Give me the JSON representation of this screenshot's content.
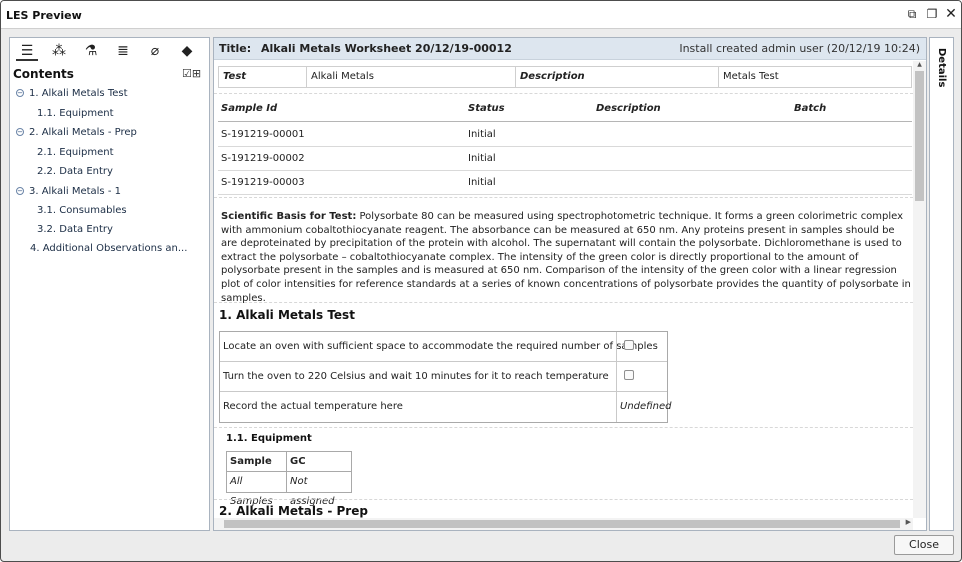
{
  "window": {
    "title": "LES Preview"
  },
  "left": {
    "contents_title": "Contents",
    "tree": [
      {
        "label": "1.  Alkali Metals Test",
        "toggle": "−"
      },
      {
        "label": "1.1.  Equipment"
      },
      {
        "label": "2.  Alkali Metals - Prep",
        "toggle": "−"
      },
      {
        "label": "2.1.  Equipment"
      },
      {
        "label": "2.2.  Data Entry"
      },
      {
        "label": "3.  Alkali Metals - 1",
        "toggle": "−"
      },
      {
        "label": "3.1.  Consumables"
      },
      {
        "label": "3.2.  Data Entry"
      },
      {
        "label": "4.  Additional Observations an..."
      }
    ]
  },
  "main": {
    "title_label": "Title:",
    "title_value": "Alkali Metals Worksheet 20/12/19-00012",
    "meta": "Install created admin user (20/12/19 10:24)",
    "test_row": {
      "test_label": "Test",
      "test_value": "Alkali Metals",
      "desc_label": "Description",
      "desc_value": "Metals Test"
    },
    "samples": {
      "headers": {
        "id": "Sample Id",
        "status": "Status",
        "description": "Description",
        "batch": "Batch"
      },
      "rows": [
        {
          "id": "S-191219-00001",
          "status": "Initial"
        },
        {
          "id": "S-191219-00002",
          "status": "Initial"
        },
        {
          "id": "S-191219-00003",
          "status": "Initial"
        }
      ]
    },
    "basis_label": "Scientific Basis for Test:",
    "basis_text": " Polysorbate 80 can be measured using spectrophotometric technique. It forms a green colorimetric complex with ammonium cobaltothiocyanate reagent. The absorbance can be measured at 650 nm. Any proteins present in samples should be are deproteinated by precipitation of the protein with alcohol. The supernatant will contain the polysorbate. Dichloromethane is used to extract the polysorbate – cobaltothiocyanate complex. The intensity of the green color is directly proportional to the amount of polysorbate present in the samples and is measured at 650 nm. Comparison of the intensity of the green color with a linear regression plot of color intensities for reference standards at a series of known concentrations of polysorbate provides the quantity of polysorbate in samples.",
    "section1_title": "1.  Alkali Metals Test",
    "steps": [
      {
        "text": "Locate an oven with sufficient space to accommodate the required number of samples"
      },
      {
        "text": "Turn the oven to 220 Celsius and wait 10  minutes for it to reach temperature"
      },
      {
        "text": "Record the actual temperature here",
        "value": "Undefined"
      }
    ],
    "sub11_title": "1.1.   Equipment",
    "equipment": {
      "h1": "Sample",
      "h2": "GC",
      "v1": "All Samples",
      "v2": "Not assigned"
    },
    "section2_title": "2.  Alkali Metals - Prep"
  },
  "details": {
    "label": "Details"
  },
  "footer": {
    "close_label": "Close"
  }
}
